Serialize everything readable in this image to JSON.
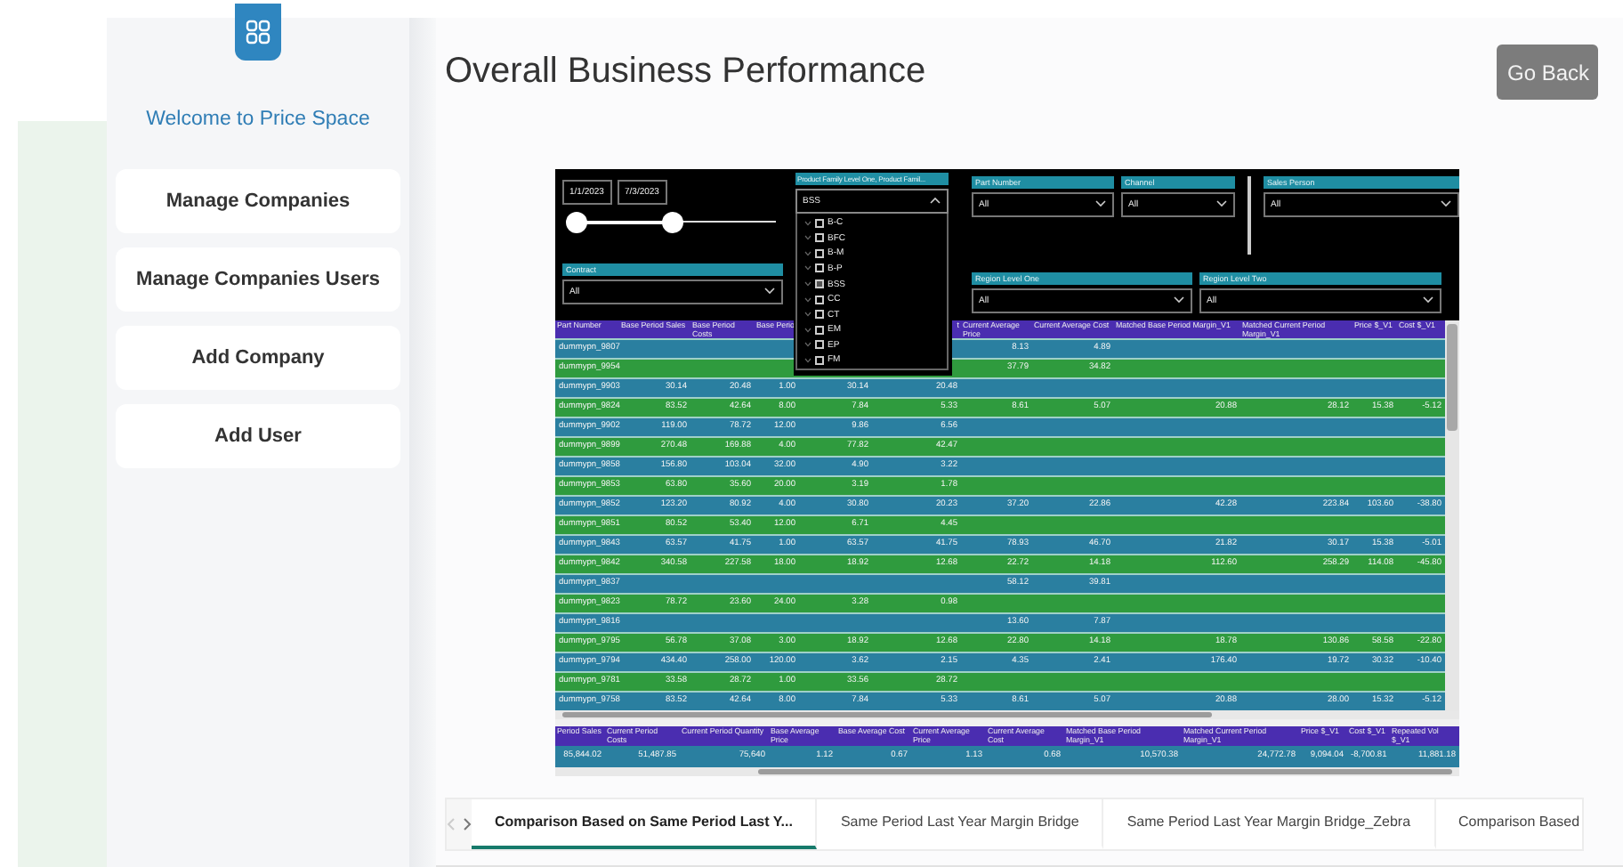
{
  "sidebar": {
    "welcome": "Welcome to Price Space",
    "items": [
      "Manage Companies",
      "Manage Companies Users",
      "Add Company",
      "Add User"
    ]
  },
  "title": "Overall Business Performance",
  "back_button": "Go Back",
  "report": {
    "date_range": {
      "start": "1/1/2023",
      "end": "7/3/2023",
      "thumbs": [
        {
          "level": 0
        },
        {
          "level": 0.48
        }
      ]
    },
    "contract_filter": {
      "label": "Contract",
      "value": "All"
    },
    "filters": [
      {
        "label": "Part Number",
        "value": "All"
      },
      {
        "label": "Channel",
        "value": "All"
      },
      {
        "label": "Sales Person",
        "value": "All"
      },
      {
        "label": "Region Level One",
        "value": "All"
      },
      {
        "label": "Region Level Two",
        "value": "All"
      }
    ],
    "dropdown": {
      "title": "Product Family Level One, Product Famil...",
      "value": "BSS",
      "expanded": true,
      "options": [
        {
          "label": "B-C",
          "checked": false
        },
        {
          "label": "BFC",
          "checked": false
        },
        {
          "label": "B-M",
          "checked": false
        },
        {
          "label": "B-P",
          "checked": false
        },
        {
          "label": "BSS",
          "checked": true
        },
        {
          "label": "CC",
          "checked": false
        },
        {
          "label": "CT",
          "checked": false
        },
        {
          "label": "EM",
          "checked": false
        },
        {
          "label": "EP",
          "checked": false
        },
        {
          "label": "FM",
          "checked": false
        }
      ]
    },
    "table": {
      "columns": [
        "Part Number",
        "Base Period Sales",
        "Base Period Costs",
        "Base Perio",
        null,
        "t",
        "Current Average Price",
        "Current Average Cost",
        "Matched Base Period Margin_V1",
        "Matched Current Period Margin_V1",
        "Price $_V1",
        "Cost $_V1"
      ],
      "rows": [
        [
          "dummypn_9807",
          null,
          null,
          null,
          null,
          null,
          "8.13",
          "4.89",
          null,
          null,
          null,
          null
        ],
        [
          "dummypn_9954",
          null,
          null,
          null,
          null,
          null,
          "37.79",
          "34.82",
          null,
          null,
          null,
          null
        ],
        [
          "dummypn_9903",
          "30.14",
          "20.48",
          "1.00",
          "30.14",
          "20.48",
          null,
          null,
          null,
          null,
          null,
          null
        ],
        [
          "dummypn_9824",
          "83.52",
          "42.64",
          "8.00",
          "7.84",
          "5.33",
          "8.61",
          "5.07",
          "20.88",
          "28.12",
          "15.38",
          "-5.12"
        ],
        [
          "dummypn_9902",
          "119.00",
          "78.72",
          "12.00",
          "9.86",
          "6.56",
          null,
          null,
          null,
          null,
          null,
          null
        ],
        [
          "dummypn_9899",
          "270.48",
          "169.88",
          "4.00",
          "77.82",
          "42.47",
          null,
          null,
          null,
          null,
          null,
          null
        ],
        [
          "dummypn_9858",
          "156.80",
          "103.04",
          "32.00",
          "4.90",
          "3.22",
          null,
          null,
          null,
          null,
          null,
          null
        ],
        [
          "dummypn_9853",
          "63.80",
          "35.60",
          "20.00",
          "3.19",
          "1.78",
          null,
          null,
          null,
          null,
          null,
          null
        ],
        [
          "dummypn_9852",
          "123.20",
          "80.92",
          "4.00",
          "30.80",
          "20.23",
          "37.20",
          "22.86",
          "42.28",
          "223.84",
          "103.60",
          "-38.80"
        ],
        [
          "dummypn_9851",
          "80.52",
          "53.40",
          "12.00",
          "6.71",
          "4.45",
          null,
          null,
          null,
          null,
          null,
          null
        ],
        [
          "dummypn_9843",
          "63.57",
          "41.75",
          "1.00",
          "63.57",
          "41.75",
          "78.93",
          "46.70",
          "21.82",
          "30.17",
          "15.38",
          "-5.01"
        ],
        [
          "dummypn_9842",
          "340.58",
          "227.58",
          "18.00",
          "18.92",
          "12.68",
          "22.72",
          "14.18",
          "112.60",
          "258.29",
          "114.08",
          "-45.80"
        ],
        [
          "dummypn_9837",
          null,
          null,
          null,
          null,
          null,
          "58.12",
          "39.81",
          null,
          null,
          null,
          null
        ],
        [
          "dummypn_9823",
          "78.72",
          "23.60",
          "24.00",
          "3.28",
          "0.98",
          null,
          null,
          null,
          null,
          null,
          null
        ],
        [
          "dummypn_9816",
          null,
          null,
          null,
          null,
          null,
          "13.60",
          "7.87",
          null,
          null,
          null,
          null
        ],
        [
          "dummypn_9795",
          "56.78",
          "37.08",
          "3.00",
          "18.92",
          "12.68",
          "22.80",
          "14.18",
          "18.78",
          "130.86",
          "58.58",
          "-22.80"
        ],
        [
          "dummypn_9794",
          "434.40",
          "258.00",
          "120.00",
          "3.62",
          "2.15",
          "4.35",
          "2.41",
          "176.40",
          "19.72",
          "30.32",
          "-10.40"
        ],
        [
          "dummypn_9781",
          "33.58",
          "28.72",
          "1.00",
          "33.56",
          "28.72",
          null,
          null,
          null,
          null,
          null,
          null
        ],
        [
          "dummypn_9758",
          "83.52",
          "42.64",
          "8.00",
          "7.84",
          "5.33",
          "8.61",
          "5.07",
          "20.88",
          "28.00",
          "15.32",
          "-5.12"
        ]
      ]
    },
    "totals": {
      "columns": [
        "Period Sales",
        "Current Period Costs",
        "Current Period Quantity",
        "Base Average Price",
        "Base Average Cost",
        "Current Average Price",
        "Current Average Cost",
        "Matched Base Period Margin_V1",
        "Matched Current Period Margin_V1",
        "Price $_V1",
        "Cost $_V1",
        "Repeated Vol $_V1"
      ],
      "values": [
        "85,844.02",
        "51,487.85",
        "75,640",
        "1.12",
        "0.67",
        "1.13",
        "0.68",
        "10,570.38",
        "24,772.78",
        "9,094.04",
        "-8,700.81",
        "11,881.18"
      ]
    }
  },
  "tabs": [
    {
      "label": "Comparison Based on Same Period Last Y...",
      "selected": true
    },
    {
      "label": "Same Period Last Year Margin Bridge",
      "selected": false
    },
    {
      "label": "Same Period Last Year Margin Bridge_Zebra",
      "selected": false
    },
    {
      "label": "Comparison Based",
      "selected": false
    }
  ]
}
